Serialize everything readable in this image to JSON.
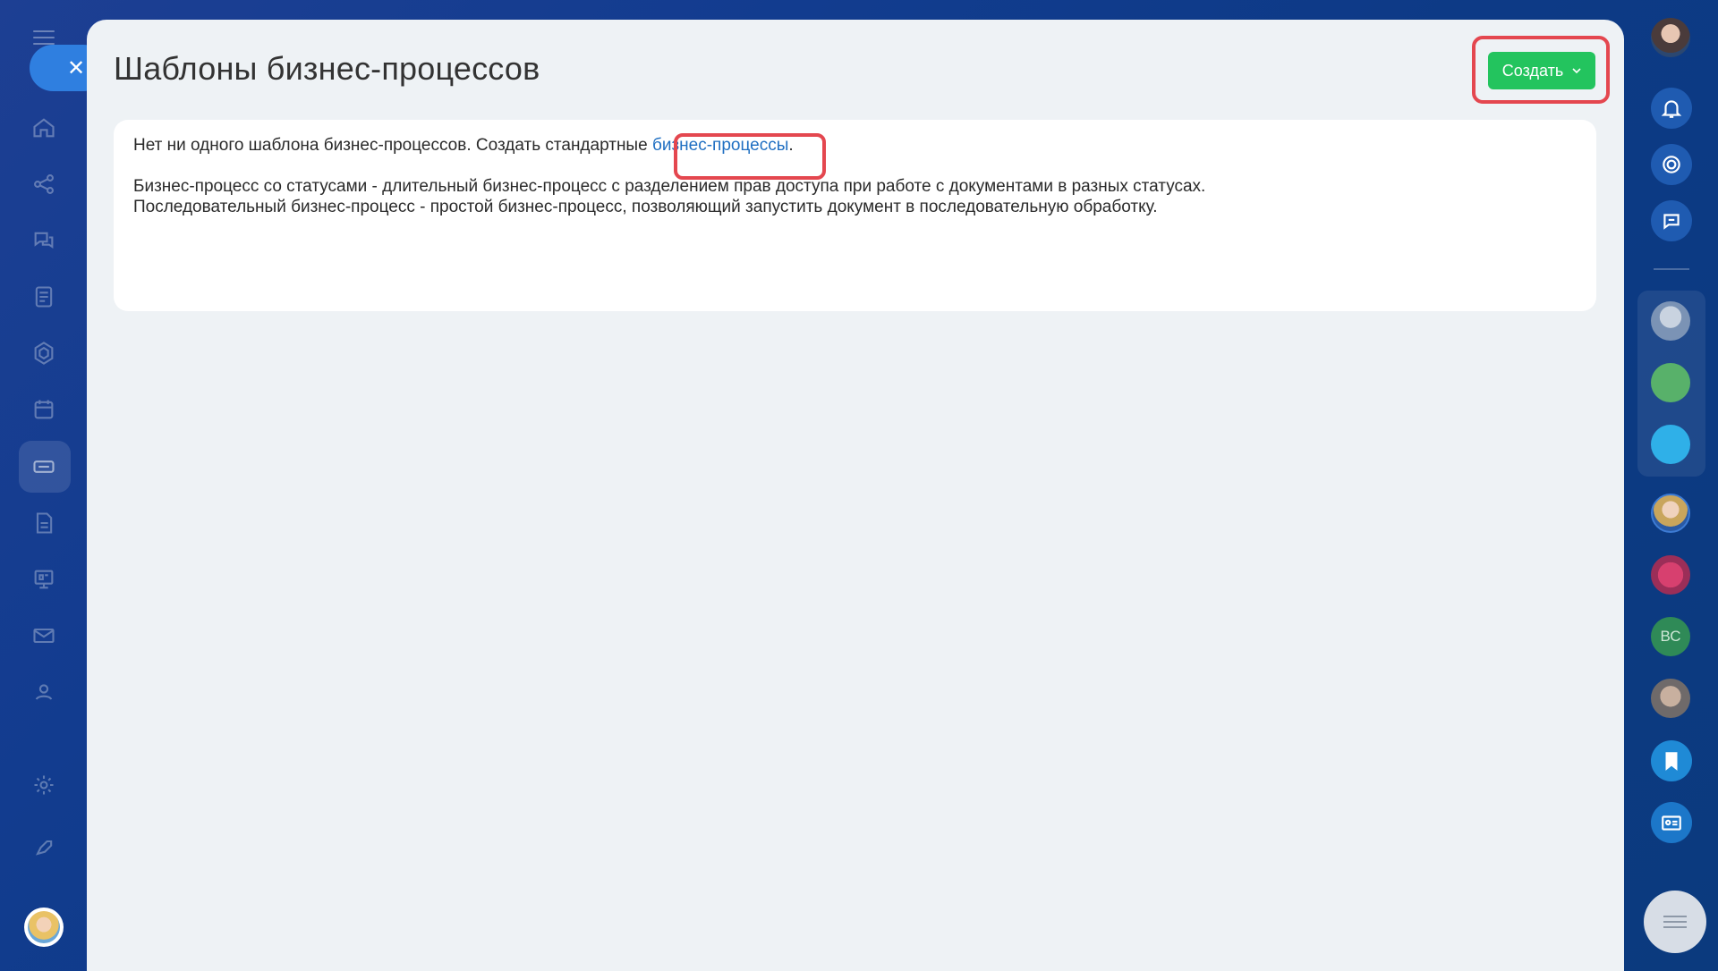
{
  "page": {
    "title": "Шаблоны бизнес-процессов",
    "create_button_label": "Создать"
  },
  "content": {
    "line1_prefix": "Нет ни одного шаблона бизнес-процессов. Создать стандартные ",
    "line1_link": "бизнес-процессы",
    "line1_suffix": ".",
    "line2": "Бизнес-процесс со статусами - длительный бизнес-процесс с разделением прав доступа при работе с документами в разных статусах.",
    "line3": "Последовательный бизнес-процесс - простой бизнес-процесс, позволяющий запустить документ в последовательную обработку."
  },
  "right_sidebar": {
    "contact_initials": "ВС"
  },
  "colors": {
    "accent_green": "#23c45e",
    "link_blue": "#1f6fc2",
    "highlight_red": "#e4474f"
  }
}
